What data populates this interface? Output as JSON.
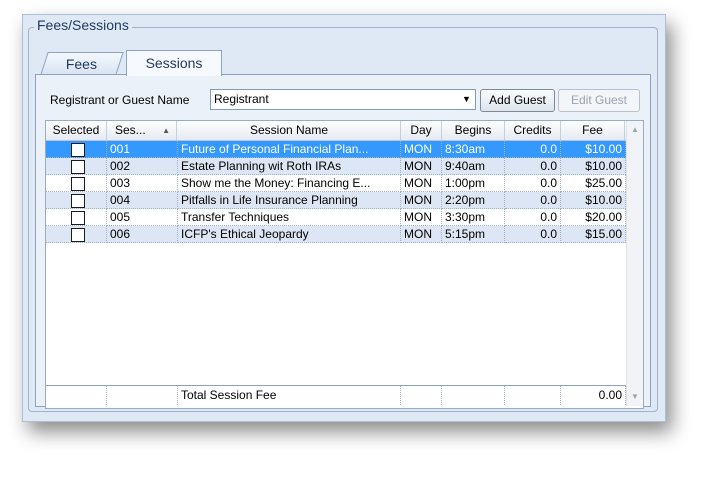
{
  "group": {
    "title": "Fees/Sessions"
  },
  "tabs": [
    {
      "label": "Fees",
      "active": false
    },
    {
      "label": "Sessions",
      "active": true
    }
  ],
  "registrant": {
    "label": "Registrant or Guest Name",
    "selected": "Registrant",
    "add_guest": "Add Guest",
    "edit_guest": "Edit Guest"
  },
  "grid": {
    "columns": [
      "Selected",
      "Ses...",
      "Session Name",
      "Day",
      "Begins",
      "Credits",
      "Fee"
    ],
    "rows": [
      {
        "id": "001",
        "name": "Future of Personal Financial Plan...",
        "day": "MON",
        "begins": "8:30am",
        "credits": "0.0",
        "fee": "$10.00",
        "selected_row": true
      },
      {
        "id": "002",
        "name": "Estate Planning wit Roth IRAs",
        "day": "MON",
        "begins": "9:40am",
        "credits": "0.0",
        "fee": "$10.00"
      },
      {
        "id": "003",
        "name": "Show me the Money: Financing E...",
        "day": "MON",
        "begins": "1:00pm",
        "credits": "0.0",
        "fee": "$25.00"
      },
      {
        "id": "004",
        "name": "Pitfalls in Life Insurance Planning",
        "day": "MON",
        "begins": "2:20pm",
        "credits": "0.0",
        "fee": "$10.00"
      },
      {
        "id": "005",
        "name": "Transfer Techniques",
        "day": "MON",
        "begins": "3:30pm",
        "credits": "0.0",
        "fee": "$20.00"
      },
      {
        "id": "006",
        "name": "ICFP's Ethical Jeopardy",
        "day": "MON",
        "begins": "5:15pm",
        "credits": "0.0",
        "fee": "$15.00"
      }
    ],
    "total_label": "Total Session Fee",
    "total_value": "0.00"
  },
  "colors": {
    "selection": "#3399ff",
    "alt_row": "#dce6f4",
    "panel": "#dfe9f6"
  },
  "icons": {
    "sort": "sort-ascending-icon",
    "dropdown": "chevron-down-icon"
  }
}
